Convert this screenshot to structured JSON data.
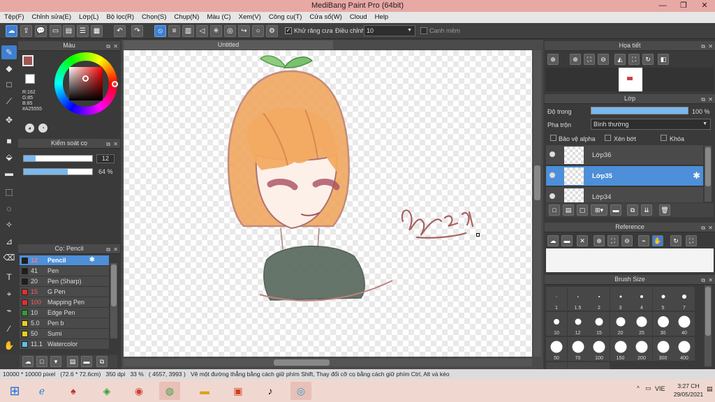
{
  "window": {
    "title": "MediBang Paint Pro (64bit)",
    "minimize": "—",
    "maximize": "❐",
    "close": "✕"
  },
  "menu": [
    "Tệp(F)",
    "Chỉnh sửa(E)",
    "Lớp(L)",
    "Bộ lọc(R)",
    "Chọn(S)",
    "Chụp(N)",
    "Màu (C)",
    "Xem(V)",
    "Công cụ(T)",
    "Cửa sổ(W)",
    "Cloud",
    "Help"
  ],
  "toolbar": {
    "antialias_label": "Khử răng cưa",
    "adjust_label": "Điều chỉnh",
    "adjust_value": "10",
    "edge_label": "Canh mềm"
  },
  "color_panel": {
    "title": "Màu",
    "r": "R:162",
    "g": "G:85",
    "b": "B:85",
    "hex": "#A25555",
    "primary": "#A25555"
  },
  "control_panel": {
    "title": "Kiểm soát cọ",
    "size": "12",
    "opacity": "64 %",
    "size_fill": 0.17,
    "opacity_fill": 0.64
  },
  "brush_panel": {
    "title": "Cọ: Pencil",
    "brushes": [
      {
        "size": "12",
        "name": "Pencil",
        "color": "#1e1e1e",
        "selected": true
      },
      {
        "size": "41",
        "name": "Pen",
        "color": "#1e1e1e"
      },
      {
        "size": "20",
        "name": "Pen (Sharp)",
        "color": "#1e1e1e"
      },
      {
        "size": "15",
        "name": "G Pen",
        "color": "#e03030"
      },
      {
        "size": "100",
        "name": "Mapping Pen",
        "color": "#e03030"
      },
      {
        "size": "10",
        "name": "Edge Pen",
        "color": "#30a030"
      },
      {
        "size": "5.0",
        "name": "Pen b",
        "color": "#e8d020"
      },
      {
        "size": "50",
        "name": "Sumi",
        "color": "#e8d020"
      },
      {
        "size": "11.1",
        "name": "Watercolor",
        "color": "#60c0e8"
      }
    ]
  },
  "canvas": {
    "tab": "Untitled",
    "signature": "Ảnh 21/7"
  },
  "navigator": {
    "title": "Họa tiết"
  },
  "layer_panel": {
    "title": "Lớp",
    "opacity_label": "Độ trong",
    "opacity_value": "100 %",
    "blend_label": "Pha trộn",
    "blend_value": "Bình thường",
    "protect_alpha": "Bảo vệ alpha",
    "clipping": "Xén bớt",
    "lock": "Khóa",
    "layers": [
      {
        "name": "Lớp36",
        "selected": false
      },
      {
        "name": "Lớp35",
        "selected": true
      },
      {
        "name": "Lớp34",
        "selected": false
      }
    ]
  },
  "reference_panel": {
    "title": "Reference"
  },
  "brush_size_panel": {
    "title": "Brush Size",
    "sizes": [
      "1",
      "1.5",
      "2",
      "3",
      "4",
      "5",
      "7",
      "10",
      "12",
      "15",
      "20",
      "25",
      "30",
      "40",
      "50",
      "70",
      "100",
      "150",
      "200",
      "300",
      "400"
    ]
  },
  "status": {
    "dimensions": "10000 * 10000 pixel",
    "physical": "(72.6 * 72.6cm)",
    "dpi": "350 dpi",
    "zoom": "33 %",
    "coords": "( 4557, 3993 )",
    "hint": "Vẽ một đường thẳng bằng cách giữ phím Shift, Thay đổi cỡ cọ bằng cách giữ phím Ctrl, Alt và kéo"
  },
  "taskbar": {
    "lang": "VIE",
    "time": "3:27 CH",
    "date": "29/05/2021"
  }
}
